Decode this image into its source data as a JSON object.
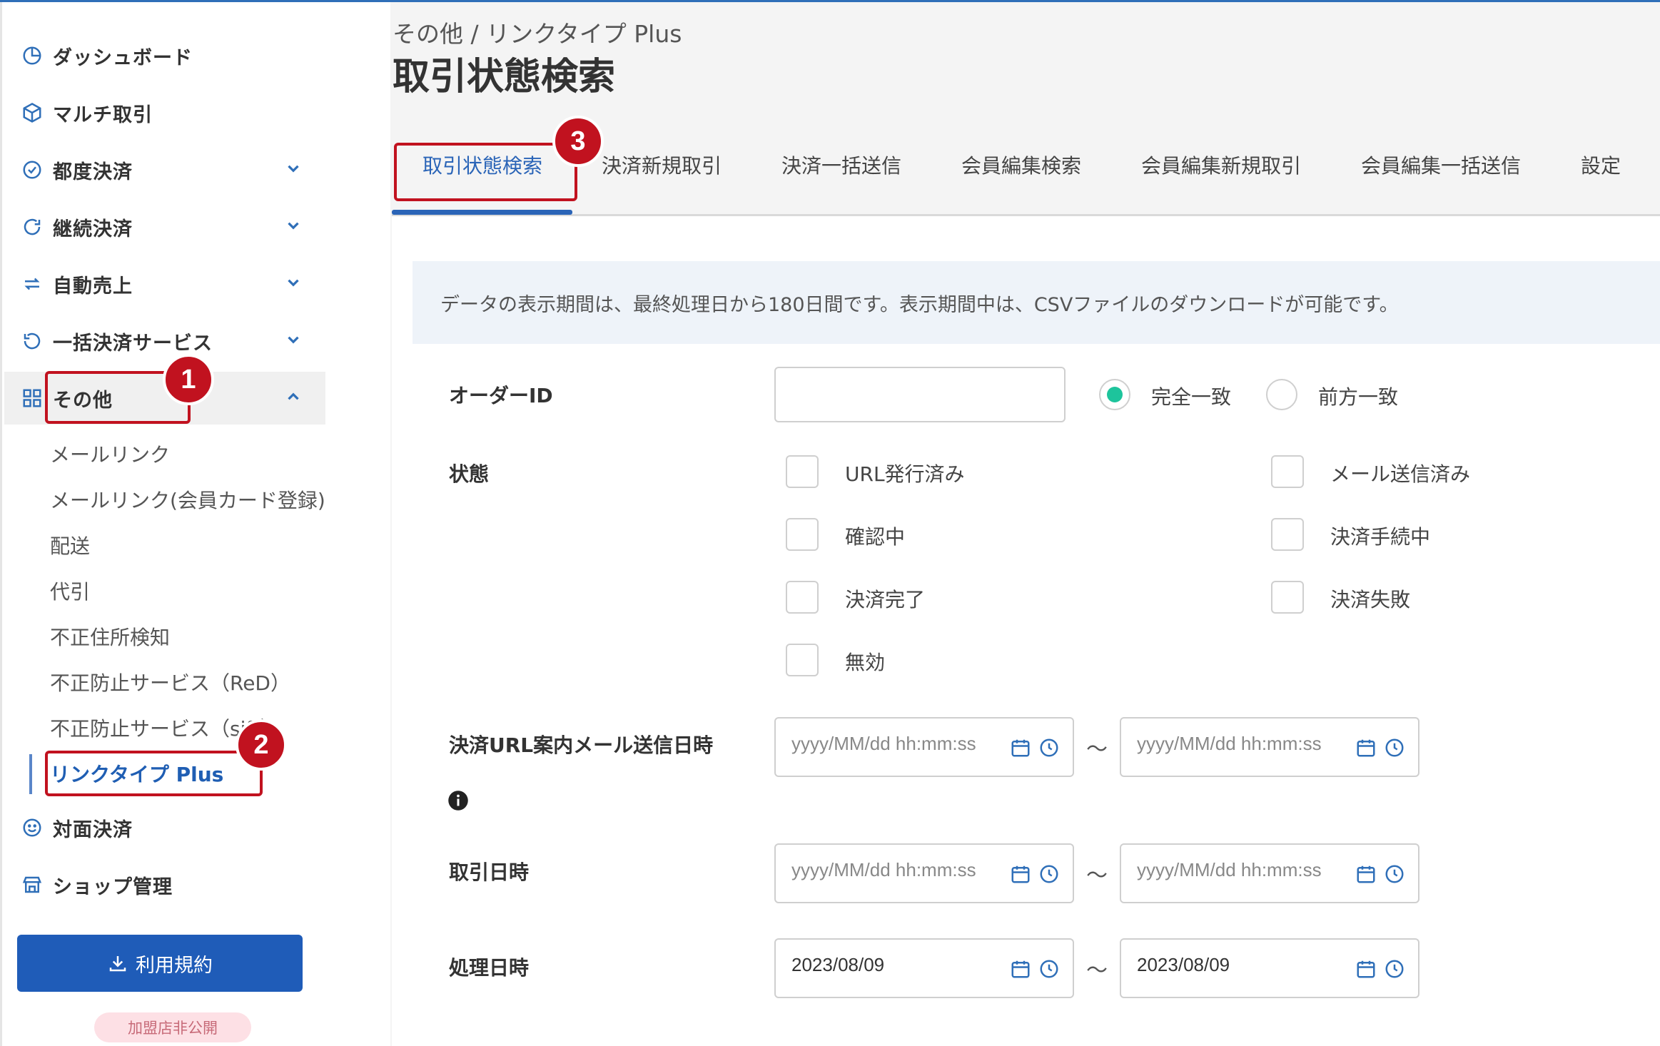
{
  "sidebar": {
    "items": [
      {
        "label": "ダッシュボード",
        "icon": "dashboard-icon"
      },
      {
        "label": "マルチ取引",
        "icon": "cube-icon"
      },
      {
        "label": "都度決済",
        "icon": "check-circle-icon"
      },
      {
        "label": "継続決済",
        "icon": "refresh-icon"
      },
      {
        "label": "自動売上",
        "icon": "exchange-icon"
      },
      {
        "label": "一括決済サービス",
        "icon": "undo-icon"
      },
      {
        "label": "その他",
        "icon": "grid-icon"
      },
      {
        "label": "対面決済",
        "icon": "smile-icon"
      },
      {
        "label": "ショップ管理",
        "icon": "shop-icon"
      }
    ],
    "sub_items": [
      "メールリンク",
      "メールリンク(会員カード登録)",
      "配送",
      "代引",
      "不正住所検知",
      "不正防止サービス（ReD）",
      "不正防止サービス（sift）",
      "リンクタイプ Plus"
    ],
    "terms_button": "利用規約",
    "private_badge": "加盟店非公開"
  },
  "header": {
    "breadcrumb": "その他 / リンクタイプ Plus",
    "title": "取引状態検索"
  },
  "tabs": [
    "取引状態検索",
    "決済新規取引",
    "決済一括送信",
    "会員編集検索",
    "会員編集新規取引",
    "会員編集一括送信",
    "設定"
  ],
  "notice": "データの表示期間は、最終処理日から180日間です。表示期間中は、CSVファイルのダウンロードが可能です。",
  "form": {
    "order_id_label": "オーダーID",
    "order_id_value": "",
    "match_exact": "完全一致",
    "match_prefix": "前方一致",
    "status_label": "状態",
    "statuses": [
      "URL発行済み",
      "メール送信済み",
      "確認中",
      "決済手続中",
      "決済完了",
      "決済失敗",
      "無効"
    ],
    "mail_sent_label": "決済URL案内メール送信日時",
    "trans_date_label": "取引日時",
    "proc_date_label": "処理日時",
    "date_placeholder": "yyyy/MM/dd hh:mm:ss",
    "proc_from": "2023/08/09",
    "proc_to": "2023/08/09",
    "tilde": "～"
  },
  "annotations": [
    "1",
    "2",
    "3"
  ],
  "colors": {
    "primary": "#1f5cb8",
    "accent_radio": "#1dc49c",
    "annotation": "#c1121f"
  }
}
